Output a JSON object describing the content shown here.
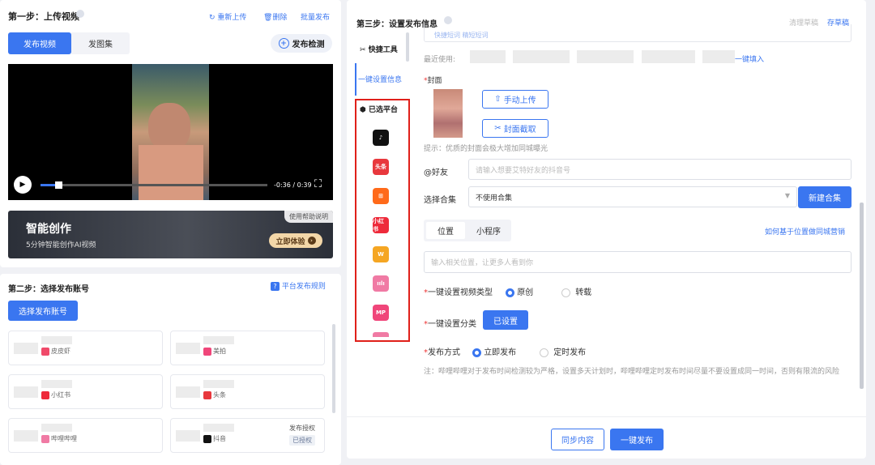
{
  "step1": {
    "title": "第一步：上传视频",
    "reupload": "重新上传",
    "delete": "删除",
    "batch": "批量发布",
    "tab_video": "发布视频",
    "tab_images": "发图集",
    "check": "发布检测",
    "time": "-0:36 / 0:39",
    "progress": 0.08
  },
  "banner": {
    "title": "智能创作",
    "subtitle": "5分钟智能创作AI视频",
    "help": "使用帮助说明",
    "try": "立即体验"
  },
  "step2": {
    "title": "第二步：选择发布账号",
    "rules": "平台发布规则",
    "choose": "选择发布账号",
    "accounts": [
      {
        "platform": "皮皮虾",
        "color": "#f04a6a"
      },
      {
        "platform": "美拍",
        "color": "#f0467a"
      },
      {
        "platform": "小红书",
        "color": "#ee2a3a"
      },
      {
        "platform": "头条",
        "color": "#e8383d"
      },
      {
        "platform": "哔哩哔哩",
        "color": "#f07aa4"
      },
      {
        "platform": "抖音",
        "color": "#111111"
      }
    ],
    "auth_label": "发布授权",
    "auth_status": "已授权"
  },
  "step3": {
    "title": "第三步：设置发布信息",
    "clear": "清理草稿",
    "save": "存草稿",
    "side_tools": "快捷工具",
    "side_quick": "一键设置信息",
    "side_selected": "已选平台",
    "platform_icons": [
      {
        "name": "douyin",
        "label": "♪",
        "color": "#111111"
      },
      {
        "name": "toutiao",
        "label": "头条",
        "color": "#e8383d"
      },
      {
        "name": "kuaishou",
        "label": "⊞",
        "color": "#ff6a1a"
      },
      {
        "name": "xiaohongshu",
        "label": "小红书",
        "color": "#ee2a3a"
      },
      {
        "name": "weishi",
        "label": "W",
        "color": "#f5a623"
      },
      {
        "name": "bilibili",
        "label": "ıılı",
        "color": "#f07aa4"
      },
      {
        "name": "meipai",
        "label": "MP",
        "color": "#f0467a"
      }
    ],
    "top_links": "快捷短词  精短短词",
    "recent_label": "最近使用:",
    "fill_link": "一键填入",
    "cover_label": "封面",
    "manual_upload": "手动上传",
    "cover_capture": "封面截取",
    "cover_tip": "提示：优质的封面会极大增加同城曝光",
    "at_label": "@好友",
    "at_placeholder": "请输入想要艾特好友的抖音号",
    "collection_label": "选择合集",
    "collection_value": "不使用合集",
    "new_collection": "新建合集",
    "loc_tab1": "位置",
    "loc_tab2": "小程序",
    "loc_link": "如何基于位置做同城营销",
    "loc_placeholder": "输入相关位置，让更多人看到你",
    "type_label": "一键设置视频类型",
    "type_original": "原创",
    "type_repost": "转载",
    "category_label": "一键设置分类",
    "category_btn": "已设置",
    "publish_label": "发布方式",
    "publish_now": "立即发布",
    "publish_timed": "定时发布",
    "note": "注：哔哩哔哩对于发布时间检测较为严格，设置多天计划时，哔哩哔哩定时发布时间尽量不要设置成同一时间，否则有限流的风险",
    "sync": "同步内容",
    "publish_all": "一键发布"
  }
}
